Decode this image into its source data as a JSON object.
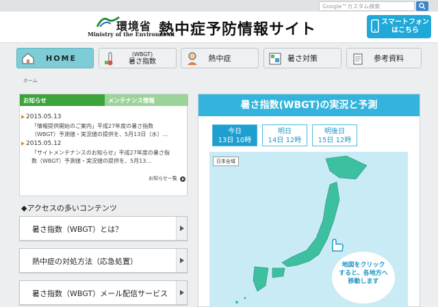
{
  "search": {
    "placeholder": "Google™カスタム検索"
  },
  "header": {
    "logo_jp": "環境省",
    "logo_en": "Ministry of the Environment",
    "title": "熱中症予防情報サイト",
    "smartphone_button": [
      "スマートフォン",
      "はこちら"
    ]
  },
  "nav": {
    "home": "HOME",
    "wbgt_small": "(WBGT)",
    "wbgt": "暑さ指数",
    "heatstroke": "熱中症",
    "measures": "暑さ対策",
    "references": "参考資料"
  },
  "breadcrumb": "ホーム",
  "news": {
    "tab_news": "お知らせ",
    "tab_maintenance": "メンテナンス情報",
    "items": [
      {
        "date": "2015.05.13",
        "lines": [
          "「情報提供開始のご案内」平成27年度の暑さ指数",
          "（WBGT）予測値・実況値の提供を、5月13日（水）…"
        ]
      },
      {
        "date": "2015.05.12",
        "lines": [
          "「サイトメンテナンスのお知らせ」平成27年度の暑さ指",
          "数（WBGT）予測値・実況値の提供を、5月13…"
        ]
      }
    ],
    "more": "お知らせ一覧"
  },
  "access": {
    "title": "◆アクセスの多いコンテンツ",
    "items": [
      "暑さ指数（WBGT）とは？",
      "熱中症の対処方法（応急処置）",
      "暑さ指数（WBGT）メール配信サービス"
    ]
  },
  "wbgt_panel": {
    "title": "暑さ指数(WBGT)の実況と予測",
    "days": [
      {
        "label": "今日",
        "time": "13日 10時"
      },
      {
        "label": "明日",
        "time": "14日 12時"
      },
      {
        "label": "明後日",
        "time": "15日 12時"
      }
    ],
    "map_label": "日本全域",
    "map_hint": [
      "地図をクリック",
      "すると、各地方へ",
      "移動します"
    ]
  },
  "colors": {
    "accent": "#34b4dc",
    "news_green": "#3aa33a",
    "home_teal": "#7ecdd6"
  }
}
